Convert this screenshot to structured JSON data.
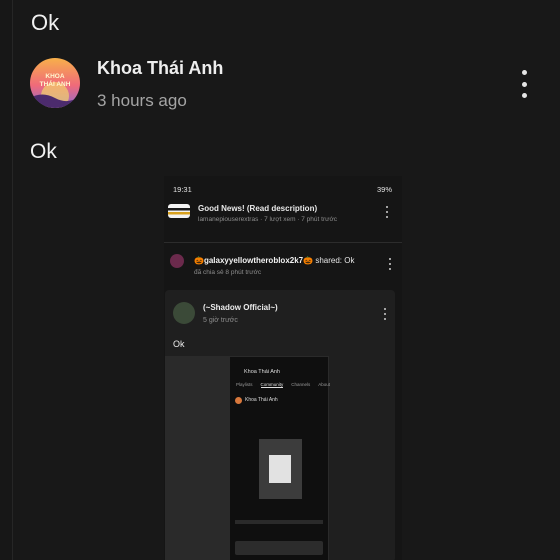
{
  "top_comment": {
    "text": "Ok"
  },
  "post": {
    "author": "Khoa Thái Anh",
    "avatar_text": "KHOA THÁI ANH",
    "timestamp": "3 hours ago",
    "text": "Ok",
    "menu_icon": "more-vertical-icon"
  },
  "embedded_screenshot": {
    "status_time": "19:31",
    "status_battery": "39%",
    "notifications": [
      {
        "title": "Good News! (Read description)",
        "subtitle": "lamanepiouserextras · 7 lượt xem · 7 phút trước"
      },
      {
        "user": "🎃galaxyyellowtheroblox2k7🎃",
        "action": "shared:",
        "message": "Ok",
        "subtitle": "đã chia sẻ 8 phút trước"
      }
    ],
    "card": {
      "author": "(~Shadow Official~)",
      "timestamp": "5 giờ trước",
      "text": "Ok",
      "inner": {
        "title": "Khoa Thái Anh",
        "tabs": [
          "Playlists",
          "Community",
          "Channels",
          "About"
        ],
        "active_tab": "Community",
        "commenter": "Khoa Thái Anh"
      }
    }
  },
  "colors": {
    "background": "#181818",
    "text": "#f2f2f2",
    "muted": "#a4a4a4"
  }
}
